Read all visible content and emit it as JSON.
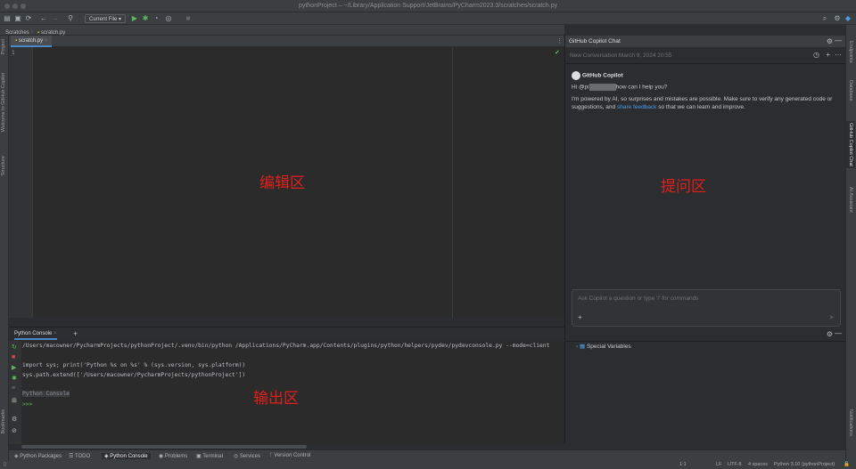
{
  "window": {
    "title": "pythonProject – ~/Library/Application Support/JetBrains/PyCharm2023.3/scratches/scratch.py"
  },
  "toolbar": {
    "run_config": "Current File ▾"
  },
  "breadcrumb": [
    "Scratches",
    "scratch.py"
  ],
  "left_stripe": [
    "Project",
    "Welcome to GitHub Copilot",
    "Structure",
    "Bookmarks"
  ],
  "right_stripe": [
    "Endpoints",
    "Database",
    "GitHub Copilot Chat",
    "AI Assistant",
    "Notifications"
  ],
  "editor": {
    "tab": "scratch.py",
    "line_number": "1",
    "annotation": "编辑区"
  },
  "copilot": {
    "title": "GitHub Copilot Chat",
    "conversation": "New Conversation March 9, 2024 20:55",
    "sender": "GitHub Copilot",
    "greeting_prefix": "Hi @pi",
    "greeting_suffix": "how can I help you?",
    "disclaimer": "I'm powered by AI, so surprises and mistakes are possible. Make sure to verify any generated code or suggestions, and",
    "link": "share feedback",
    "disclaimer_end": "so that we can learn and improve.",
    "input_placeholder": "Ask Copilot a question or type '/' for commands",
    "annotation": "提问区"
  },
  "console": {
    "tab": "Python Console",
    "lines": [
      "/Users/macowner/PycharmProjects/pythonProject/.venv/bin/python /Applications/PyCharm.app/Contents/plugins/python/helpers/pydev/pydevconsole.py --mode=client",
      "",
      "import sys; print('Python %s on %s' % (sys.version, sys.platform))",
      "sys.path.extend(['/Users/macowner/PycharmProjects/pythonProject'])",
      "",
      "Python Console"
    ],
    "prompt": ">>>",
    "annotation": "输出区"
  },
  "variables": {
    "item": "Special Variables"
  },
  "tool_windows": [
    "Python Packages",
    "TODO",
    "Python Console",
    "Problems",
    "Terminal",
    "Services",
    "Version Control"
  ],
  "status": [
    "1:1",
    "LF",
    "UTF-8",
    "4 spaces",
    "Python 3.10 (pythonProject)"
  ]
}
